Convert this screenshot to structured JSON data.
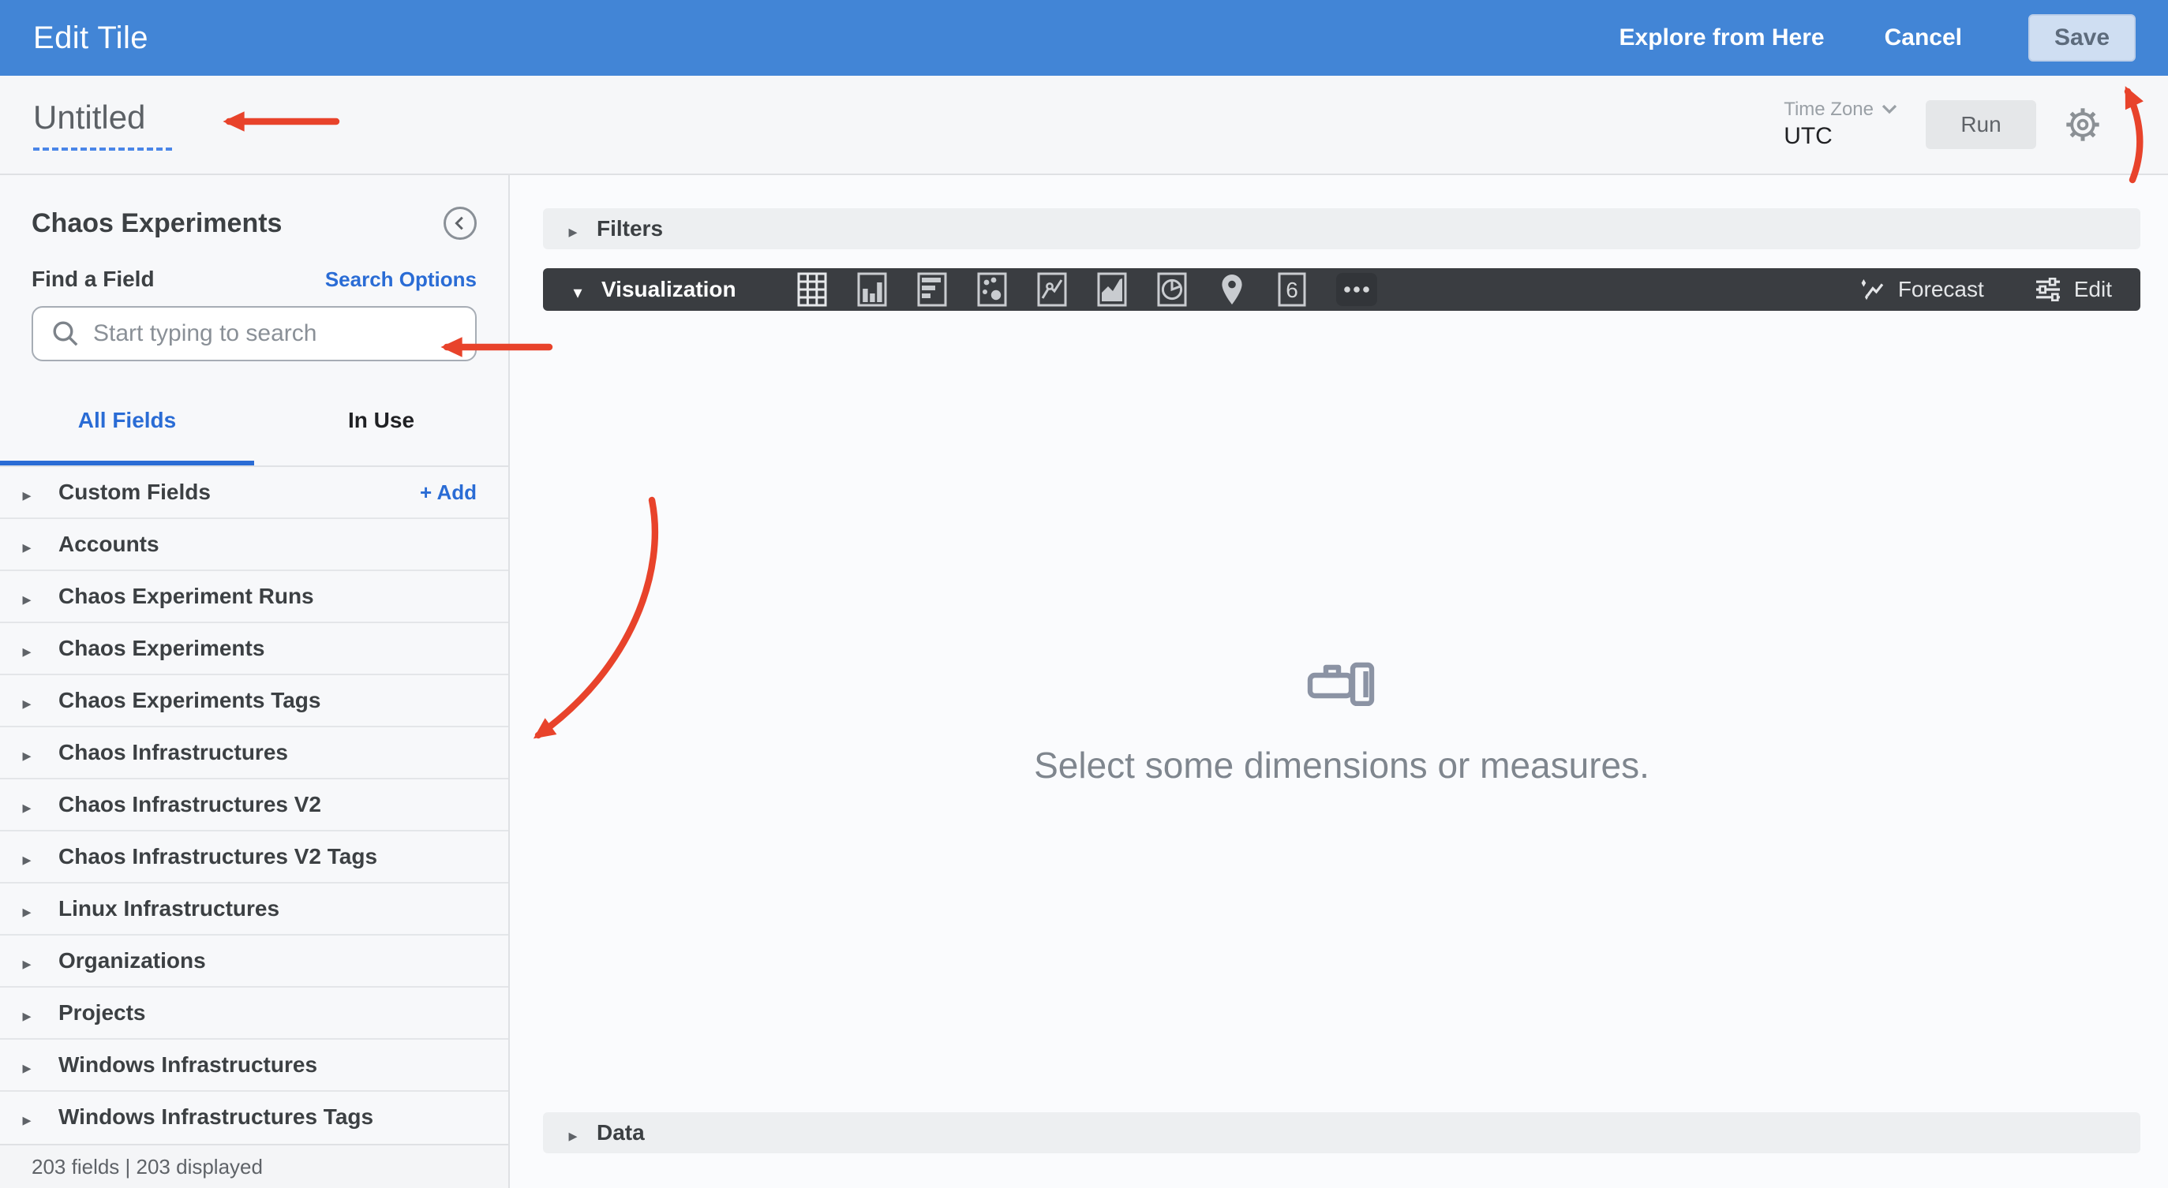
{
  "top_bar": {
    "title": "Edit Tile",
    "explore_label": "Explore from Here",
    "cancel_label": "Cancel",
    "save_label": "Save"
  },
  "header": {
    "title": "Untitled",
    "timezone_label": "Time Zone",
    "timezone_value": "UTC",
    "run_label": "Run"
  },
  "sidebar": {
    "title": "Chaos Experiments",
    "find_field_label": "Find a Field",
    "search_options_label": "Search Options",
    "search_placeholder": "Start typing to search",
    "tabs": [
      {
        "label": "All Fields",
        "active": true
      },
      {
        "label": "In Use",
        "active": false
      }
    ],
    "custom_fields_label": "Custom Fields",
    "add_label": "+ Add",
    "groups": [
      "Accounts",
      "Chaos Experiment Runs",
      "Chaos Experiments",
      "Chaos Experiments Tags",
      "Chaos Infrastructures",
      "Chaos Infrastructures V2",
      "Chaos Infrastructures V2 Tags",
      "Linux Infrastructures",
      "Organizations",
      "Projects",
      "Windows Infrastructures",
      "Windows Infrastructures Tags"
    ],
    "footer": "203 fields | 203 displayed"
  },
  "main": {
    "filters_label": "Filters",
    "visualization_label": "Visualization",
    "viz_types": [
      "table",
      "column",
      "bar",
      "scatter",
      "line",
      "area",
      "pie",
      "map",
      "single-value",
      "more"
    ],
    "single_value_glyph": "6",
    "forecast_label": "Forecast",
    "edit_label": "Edit",
    "empty_message": "Select some dimensions or measures.",
    "data_label": "Data"
  },
  "icons": {
    "caret_right": "▸",
    "caret_down": "▾",
    "collapse_chevron": "‹",
    "more_dots": "•••"
  },
  "colors": {
    "topbar_blue": "#4285d6",
    "accent_blue": "#2a6cd5",
    "viz_bar_dark": "#3a3d41",
    "annotation_red": "#e8432b",
    "save_button_bg": "#cfdef2"
  }
}
